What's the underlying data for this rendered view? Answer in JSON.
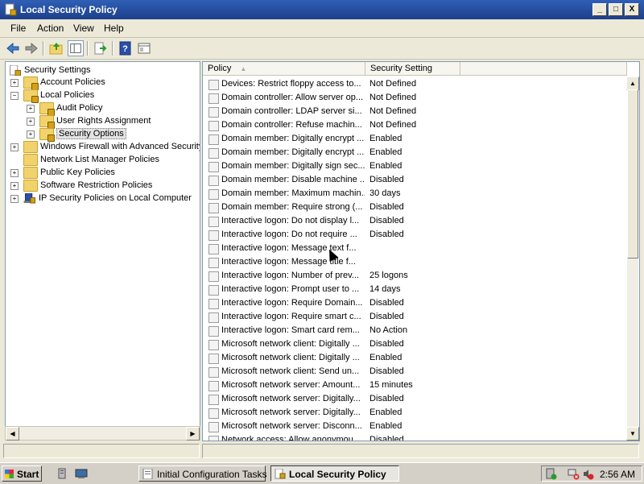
{
  "window": {
    "title": "Local Security Policy",
    "controls": {
      "minimize": "_",
      "maximize": "□",
      "close": "X"
    }
  },
  "menu": [
    "File",
    "Action",
    "View",
    "Help"
  ],
  "toolbar": {
    "icons": [
      "back-arrow-icon",
      "forward-arrow-icon",
      "up-folder-icon",
      "show-hide-tree-icon",
      "export-list-icon",
      "help-icon",
      "properties-icon"
    ]
  },
  "tree": {
    "root": "Security Settings",
    "nodes": [
      {
        "label": "Account Policies",
        "expander": "+"
      },
      {
        "label": "Local Policies",
        "expander": "−"
      },
      {
        "label": "Audit Policy",
        "expander": "+"
      },
      {
        "label": "User Rights Assignment",
        "expander": "+"
      },
      {
        "label": "Security Options",
        "expander": "+",
        "selected": true
      },
      {
        "label": "Windows Firewall with Advanced Security",
        "expander": "+"
      },
      {
        "label": "Network List Manager Policies",
        "expander": ""
      },
      {
        "label": "Public Key Policies",
        "expander": "+"
      },
      {
        "label": "Software Restriction Policies",
        "expander": "+"
      },
      {
        "label": "IP Security Policies on Local Computer",
        "expander": "+"
      }
    ]
  },
  "list": {
    "columns": [
      "Policy",
      "Security Setting"
    ],
    "rows": [
      {
        "policy": "Devices: Restrict floppy access to...",
        "setting": "Not Defined"
      },
      {
        "policy": "Domain controller: Allow server op...",
        "setting": "Not Defined"
      },
      {
        "policy": "Domain controller: LDAP server si...",
        "setting": "Not Defined"
      },
      {
        "policy": "Domain controller: Refuse machin...",
        "setting": "Not Defined"
      },
      {
        "policy": "Domain member: Digitally encrypt ...",
        "setting": "Enabled"
      },
      {
        "policy": "Domain member: Digitally encrypt ...",
        "setting": "Enabled"
      },
      {
        "policy": "Domain member: Digitally sign sec...",
        "setting": "Enabled"
      },
      {
        "policy": "Domain member: Disable machine ...",
        "setting": "Disabled"
      },
      {
        "policy": "Domain member: Maximum machin...",
        "setting": "30 days"
      },
      {
        "policy": "Domain member: Require strong (...",
        "setting": "Disabled"
      },
      {
        "policy": "Interactive logon: Do not display l...",
        "setting": "Disabled"
      },
      {
        "policy": "Interactive logon: Do not require ...",
        "setting": "Disabled"
      },
      {
        "policy": "Interactive logon: Message text f...",
        "setting": ""
      },
      {
        "policy": "Interactive logon: Message title f...",
        "setting": ""
      },
      {
        "policy": "Interactive logon: Number of prev...",
        "setting": "25 logons"
      },
      {
        "policy": "Interactive logon: Prompt user to ...",
        "setting": "14 days"
      },
      {
        "policy": "Interactive logon: Require Domain...",
        "setting": "Disabled"
      },
      {
        "policy": "Interactive logon: Require smart c...",
        "setting": "Disabled"
      },
      {
        "policy": "Interactive logon: Smart card rem...",
        "setting": "No Action"
      },
      {
        "policy": "Microsoft network client: Digitally ...",
        "setting": "Disabled"
      },
      {
        "policy": "Microsoft network client: Digitally ...",
        "setting": "Enabled"
      },
      {
        "policy": "Microsoft network client: Send un...",
        "setting": "Disabled"
      },
      {
        "policy": "Microsoft network server: Amount...",
        "setting": "15 minutes"
      },
      {
        "policy": "Microsoft network server: Digitally...",
        "setting": "Disabled"
      },
      {
        "policy": "Microsoft network server: Digitally...",
        "setting": "Enabled"
      },
      {
        "policy": "Microsoft network server: Disconn...",
        "setting": "Enabled"
      },
      {
        "policy": "Network access: Allow anonymou...",
        "setting": "Disabled"
      }
    ]
  },
  "taskbar": {
    "start": "Start",
    "tasks": [
      {
        "label": "Initial Configuration Tasks",
        "active": false
      },
      {
        "label": "Local Security Policy",
        "active": true
      }
    ],
    "clock": "2:56 AM"
  }
}
